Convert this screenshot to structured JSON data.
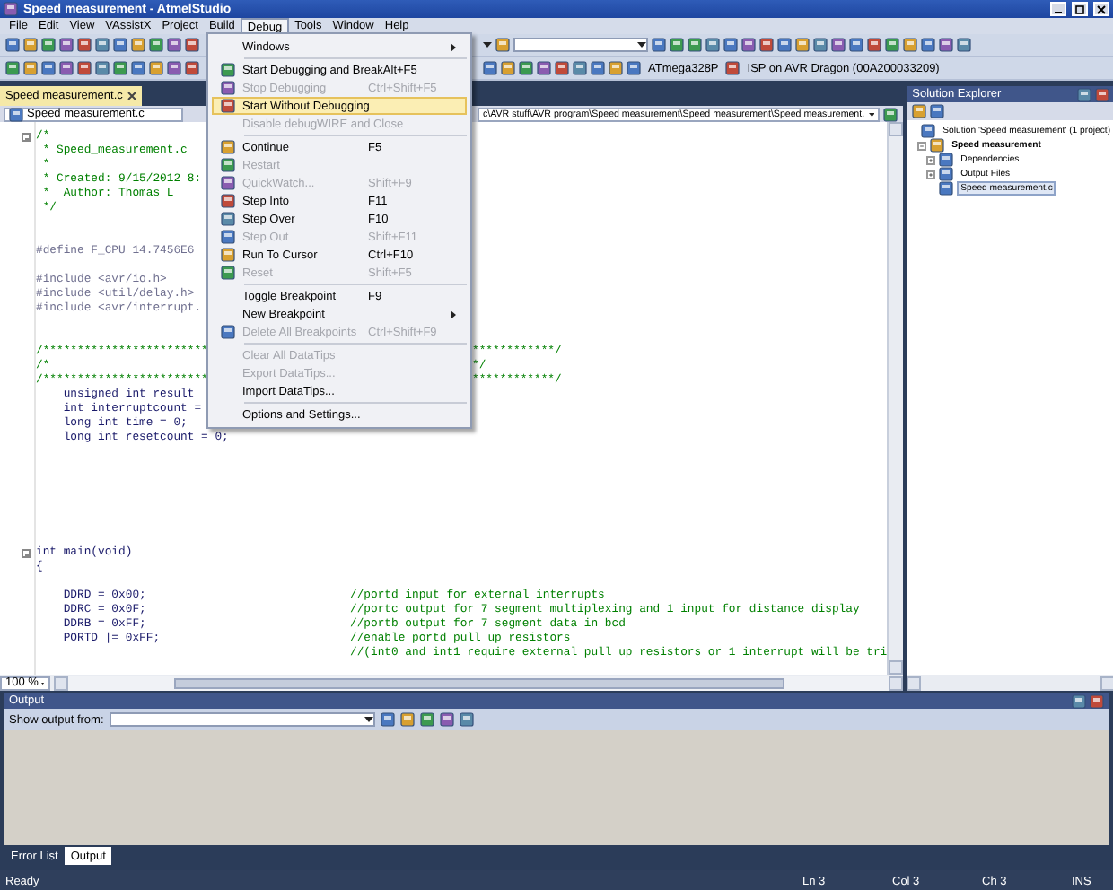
{
  "window": {
    "title": "Speed measurement - AtmelStudio"
  },
  "menu_bar": [
    {
      "label": "File",
      "selected": false
    },
    {
      "label": "Edit",
      "selected": false
    },
    {
      "label": "View",
      "selected": false
    },
    {
      "label": "VAssistX",
      "selected": false
    },
    {
      "label": "Project",
      "selected": false
    },
    {
      "label": "Build",
      "selected": false
    },
    {
      "label": "Debug",
      "selected": true
    },
    {
      "label": "Tools",
      "selected": false
    },
    {
      "label": "Window",
      "selected": false
    },
    {
      "label": "Help",
      "selected": false
    }
  ],
  "toolbar": {
    "device": "ATmega328P",
    "tool": "ISP on AVR Dragon (00A200033209)"
  },
  "document_tabs": [
    {
      "label": "Speed measurement.c",
      "selected": true
    }
  ],
  "navigation_bar": {
    "file": "Speed measurement.c",
    "path": "c\\AVR stuff\\AVR program\\Speed measurement\\Speed measurement\\Speed measurement."
  },
  "editor": {
    "zoom": "100 %",
    "lines": [
      {
        "kind": "comment",
        "text": "/*",
        "fold": true
      },
      {
        "kind": "comment",
        "text": " * Speed_measurement.c"
      },
      {
        "kind": "comment",
        "text": " *"
      },
      {
        "kind": "comment",
        "text": " * Created: 9/15/2012 8:"
      },
      {
        "kind": "comment",
        "text": " *  Author: Thomas L"
      },
      {
        "kind": "comment",
        "text": " */"
      },
      {
        "kind": "blank"
      },
      {
        "kind": "blank"
      },
      {
        "kind": "preproc",
        "text": "#define F_CPU 14.7456E6"
      },
      {
        "kind": "blank"
      },
      {
        "kind": "preproc",
        "text": "#include <avr/io.h>"
      },
      {
        "kind": "preproc",
        "text": "#include <util/delay.h>"
      },
      {
        "kind": "preproc",
        "text": "#include <avr/interrupt."
      },
      {
        "kind": "blank"
      },
      {
        "kind": "blank"
      },
      {
        "kind": "comment",
        "text": "/************************",
        "tail": "************/"
      },
      {
        "kind": "comment",
        "text": "/*",
        "tail": "*/"
      },
      {
        "kind": "comment",
        "text": "/************************",
        "tail": "************/"
      },
      {
        "kind": "code",
        "text": "    unsigned int result"
      },
      {
        "kind": "code",
        "text": "    int interruptcount ="
      },
      {
        "kind": "code",
        "text": "    long int time = 0;"
      },
      {
        "kind": "code",
        "text": "    long int resetcount = 0;"
      },
      {
        "kind": "blank"
      },
      {
        "kind": "blank"
      },
      {
        "kind": "blank"
      },
      {
        "kind": "blank"
      },
      {
        "kind": "blank"
      },
      {
        "kind": "blank"
      },
      {
        "kind": "blank"
      },
      {
        "kind": "code",
        "text": "int main(void)",
        "fold": true
      },
      {
        "kind": "code",
        "text": "{"
      },
      {
        "kind": "blank"
      },
      {
        "kind": "code",
        "text": "    DDRD = 0x00;",
        "comment": "//portd input for external interrupts"
      },
      {
        "kind": "code",
        "text": "    DDRC = 0x0F;",
        "comment": "//portc output for 7 segment multiplexing and 1 input for distance display"
      },
      {
        "kind": "code",
        "text": "    DDRB = 0xFF;",
        "comment": "//portb output for 7 segment data in bcd"
      },
      {
        "kind": "code",
        "text": "    PORTD |= 0xFF;",
        "comment": "//enable portd pull up resistors"
      },
      {
        "kind": "comment",
        "comment": "//(int0 and int1 require external pull up resistors or 1 interrupt will be tri"
      }
    ]
  },
  "debug_menu": {
    "items": [
      {
        "kind": "item",
        "label": "Windows",
        "submenu": true,
        "disabled": false,
        "selected": false
      },
      {
        "kind": "separator"
      },
      {
        "kind": "item",
        "label": "Start Debugging and Break",
        "shortcut": "Alt+F5",
        "icon": true,
        "disabled": false,
        "selected": false
      },
      {
        "kind": "item",
        "label": "Stop Debugging",
        "shortcut": "Ctrl+Shift+F5",
        "icon": true,
        "disabled": true,
        "selected": false
      },
      {
        "kind": "item",
        "label": "Start Without Debugging",
        "icon": true,
        "disabled": false,
        "selected": true
      },
      {
        "kind": "item",
        "label": "Disable debugWIRE and Close",
        "disabled": true,
        "selected": false
      },
      {
        "kind": "separator"
      },
      {
        "kind": "item",
        "label": "Continue",
        "shortcut": "F5",
        "icon": true,
        "disabled": false,
        "selected": false
      },
      {
        "kind": "item",
        "label": "Restart",
        "icon": true,
        "disabled": true,
        "selected": false
      },
      {
        "kind": "item",
        "label": "QuickWatch...",
        "shortcut": "Shift+F9",
        "icon": true,
        "disabled": true,
        "selected": false
      },
      {
        "kind": "item",
        "label": "Step Into",
        "shortcut": "F11",
        "icon": true,
        "disabled": false,
        "selected": false
      },
      {
        "kind": "item",
        "label": "Step Over",
        "shortcut": "F10",
        "icon": true,
        "disabled": false,
        "selected": false
      },
      {
        "kind": "item",
        "label": "Step Out",
        "shortcut": "Shift+F11",
        "icon": true,
        "disabled": true,
        "selected": false
      },
      {
        "kind": "item",
        "label": "Run To Cursor",
        "shortcut": "Ctrl+F10",
        "icon": true,
        "disabled": false,
        "selected": false
      },
      {
        "kind": "item",
        "label": "Reset",
        "shortcut": "Shift+F5",
        "icon": true,
        "disabled": true,
        "selected": false
      },
      {
        "kind": "separator"
      },
      {
        "kind": "item",
        "label": "Toggle Breakpoint",
        "shortcut": "F9",
        "disabled": false,
        "selected": false
      },
      {
        "kind": "item",
        "label": "New Breakpoint",
        "submenu": true,
        "disabled": false,
        "selected": false
      },
      {
        "kind": "item",
        "label": "Delete All Breakpoints",
        "shortcut": "Ctrl+Shift+F9",
        "icon": true,
        "disabled": true,
        "selected": false
      },
      {
        "kind": "separator"
      },
      {
        "kind": "item",
        "label": "Clear All DataTips",
        "disabled": true,
        "selected": false
      },
      {
        "kind": "item",
        "label": "Export DataTips...",
        "disabled": true,
        "selected": false
      },
      {
        "kind": "item",
        "label": "Import DataTips...",
        "disabled": false,
        "selected": false
      },
      {
        "kind": "separator"
      },
      {
        "kind": "item",
        "label": "Options and Settings...",
        "disabled": false,
        "selected": false
      }
    ]
  },
  "solution_explorer": {
    "title": "Solution Explorer",
    "tree": [
      {
        "label": "Solution 'Speed measurement' (1 project)",
        "bold": false,
        "selected": false,
        "children": [
          {
            "label": "Speed measurement",
            "bold": true,
            "selected": false,
            "expanded": true,
            "children": [
              {
                "label": "Dependencies",
                "bold": false,
                "selected": false,
                "expanded": false
              },
              {
                "label": "Output Files",
                "bold": false,
                "selected": false,
                "expanded": false
              },
              {
                "label": "Speed measurement.c",
                "bold": false,
                "selected": true
              }
            ]
          }
        ]
      }
    ]
  },
  "output": {
    "title": "Output",
    "source_label": "Show output from:"
  },
  "bottom_tabs": [
    {
      "label": "Error List",
      "selected": false
    },
    {
      "label": "Output",
      "selected": true
    }
  ],
  "status_bar": {
    "message": "Ready",
    "line": "Ln 3",
    "column": "Col 3",
    "char": "Ch 3",
    "mode": "INS"
  }
}
